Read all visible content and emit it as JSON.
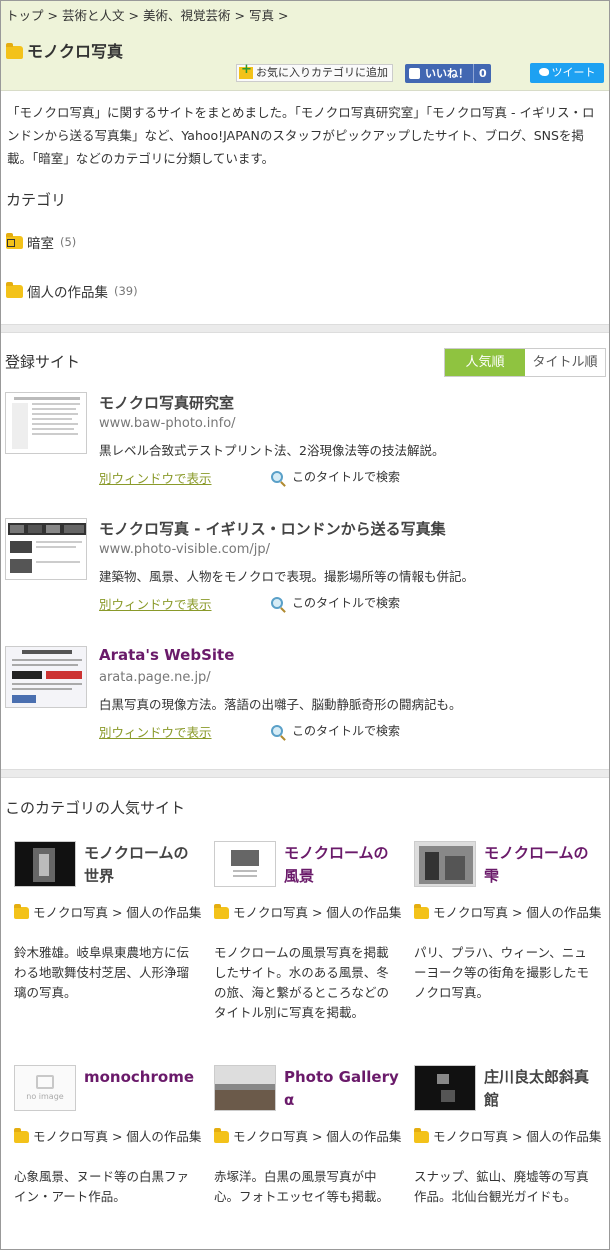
{
  "breadcrumb": {
    "items": [
      "トップ",
      "芸術と人文",
      "美術、視覚芸術",
      "写真"
    ],
    "separator": ">"
  },
  "page": {
    "title": "モノクロ写真",
    "intro": "「モノクロ写真」に関するサイトをまとめました。「モノクロ写真研究室」「モノクロ写真 - イギリス・ロンドンから送る写真集」など、Yahoo!JAPANのスタッフがピックアップしたサイト、ブログ、SNSを掲載。「暗室」などのカテゴリに分類しています。"
  },
  "actions": {
    "favorite_label": "お気に入りカテゴリに追加",
    "like_label": "いいね！",
    "like_count": "0",
    "tweet_label": "ツイート"
  },
  "categories": {
    "heading": "カテゴリ",
    "items": [
      {
        "label": "暗室",
        "count": "(5)",
        "icon": "darkroom-folder-icon"
      },
      {
        "label": "個人の作品集",
        "count": "(39)",
        "icon": "folder-icon"
      }
    ]
  },
  "registered": {
    "heading": "登録サイト",
    "sort_tabs": [
      "人気順",
      "タイトル順"
    ],
    "open_label": "別ウィンドウで表示",
    "search_label": "このタイトルで検索",
    "sites": [
      {
        "name": "モノクロ写真研究室",
        "url": "www.baw-photo.info/",
        "desc": "黒レベル合致式テストプリント法、2浴現像法等の技法解説。"
      },
      {
        "name": "モノクロ写真 - イギリス・ロンドンから送る写真集",
        "url": "www.photo-visible.com/jp/",
        "desc": "建築物、風景、人物をモノクロで表現。撮影場所等の情報も併記。"
      },
      {
        "name": "Arata's WebSite",
        "url": "arata.page.ne.jp/",
        "desc": "白黒写真の現像方法。落語の出囃子、脳動静脈奇形の闘病記も。"
      }
    ]
  },
  "popular": {
    "heading": "このカテゴリの人気サイト",
    "category_path": "モノクロ写真 > 個人の作品集",
    "no_image_label": "no image",
    "sites": [
      {
        "name": "モノクロームの世界",
        "desc": "鈴木雅雄。岐阜県東農地方に伝わる地歌舞伎村芝居、人形浄瑠璃の写真。"
      },
      {
        "name": "モノクロームの風景",
        "desc": "モノクロームの風景写真を掲載したサイト。水のある風景、冬の旅、海と繋がるところなどのタイトル別に写真を掲載。"
      },
      {
        "name": "モノクロームの雫",
        "desc": "パリ、プラハ、ウィーン、ニューヨーク等の街角を撮影したモノクロ写真。"
      },
      {
        "name": "monochrome",
        "desc": "心象風景、ヌード等の白黒ファイン・アート作品。"
      },
      {
        "name": "Photo Gallery α",
        "desc": "赤塚洋。白黒の風景写真が中心。フォトエッセイ等も掲載。"
      },
      {
        "name": "庄川良太郎斜真館",
        "desc": "スナップ、鉱山、廃墟等の写真作品。北仙台観光ガイドも。"
      }
    ]
  },
  "colors": {
    "header_bg": "#eef3d9",
    "accent_green": "#8fc340",
    "link_visited": "#6a1a6a",
    "facebook": "#4267b2",
    "twitter": "#1da1f2"
  }
}
